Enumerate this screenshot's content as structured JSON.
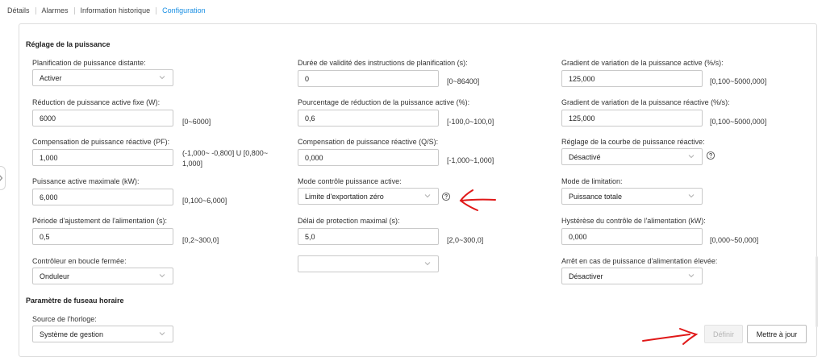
{
  "tabs": [
    {
      "label": "Détails",
      "active": false
    },
    {
      "label": "Alarmes",
      "active": false
    },
    {
      "label": "Information historique",
      "active": false
    },
    {
      "label": "Configuration",
      "active": true
    }
  ],
  "sections": {
    "power": "Réglage de la puissance",
    "timezone": "Paramètre de fuseau horaire"
  },
  "fields": {
    "remote_planning": {
      "label": "Planification de puissance distante:",
      "value": "Activer"
    },
    "fixed_active_reduction": {
      "label": "Réduction de puissance active fixe (W):",
      "value": "6000",
      "range": "[0~6000]"
    },
    "reactive_pf": {
      "label": "Compensation de puissance réactive (PF):",
      "value": "1,000",
      "range_line1": "(-1,000~ -0,800] U [0,800~",
      "range_line2": "1,000]"
    },
    "max_active_power": {
      "label": "Puissance active maximale (kW):",
      "value": "6,000",
      "range": "[0,100~6,000]"
    },
    "supply_adjust_period": {
      "label": "Période d'ajustement de l'alimentation (s):",
      "value": "0,5",
      "range": "[0,2~300,0]"
    },
    "closed_loop_controller": {
      "label": "Contrôleur en boucle fermée:",
      "value": "Onduleur"
    },
    "instruction_validity": {
      "label": "Durée de validité des instructions de planification (s):",
      "value": "0",
      "range": "[0~86400]"
    },
    "active_reduction_pct": {
      "label": "Pourcentage de réduction de la puissance active (%):",
      "value": "0,6",
      "range": "[-100,0~100,0]"
    },
    "reactive_qs": {
      "label": "Compensation de puissance réactive (Q/S):",
      "value": "0,000",
      "range": "[-1,000~1,000]"
    },
    "active_control_mode": {
      "label": "Mode contrôle puissance active:",
      "value": "Limite d'exportation zéro"
    },
    "max_protection_delay": {
      "label": "Délai de protection maximal (s):",
      "value": "5,0",
      "range": "[2,0~300,0]"
    },
    "empty_select": {
      "value": ""
    },
    "active_gradient": {
      "label": "Gradient de variation de la puissance active (%/s):",
      "value": "125,000",
      "range": "[0,100~5000,000]"
    },
    "reactive_gradient": {
      "label": "Gradient de variation de la puissance réactive (%/s):",
      "value": "125,000",
      "range": "[0,100~5000,000]"
    },
    "reactive_curve": {
      "label": "Réglage de la courbe de puissance réactive:",
      "value": "Désactivé"
    },
    "limitation_mode": {
      "label": "Mode de limitation:",
      "value": "Puissance totale"
    },
    "supply_hysteresis": {
      "label": "Hystérèse du contrôle de l'alimentation (kW):",
      "value": "0,000",
      "range": "[0,000~50,000]"
    },
    "high_power_stop": {
      "label": "Arrêt en cas de puissance d'alimentation élevée:",
      "value": "Désactiver"
    },
    "clock_source": {
      "label": "Source de l'horloge:",
      "value": "Système de gestion"
    }
  },
  "buttons": {
    "define": "Définir",
    "update": "Mettre à jour"
  },
  "icons": {
    "help": "help-circle-icon",
    "chevron": "chevron-down-icon",
    "side": "chevron-right-icon"
  },
  "colors": {
    "accent": "#1a8fe3",
    "annotation": "#e01818"
  }
}
